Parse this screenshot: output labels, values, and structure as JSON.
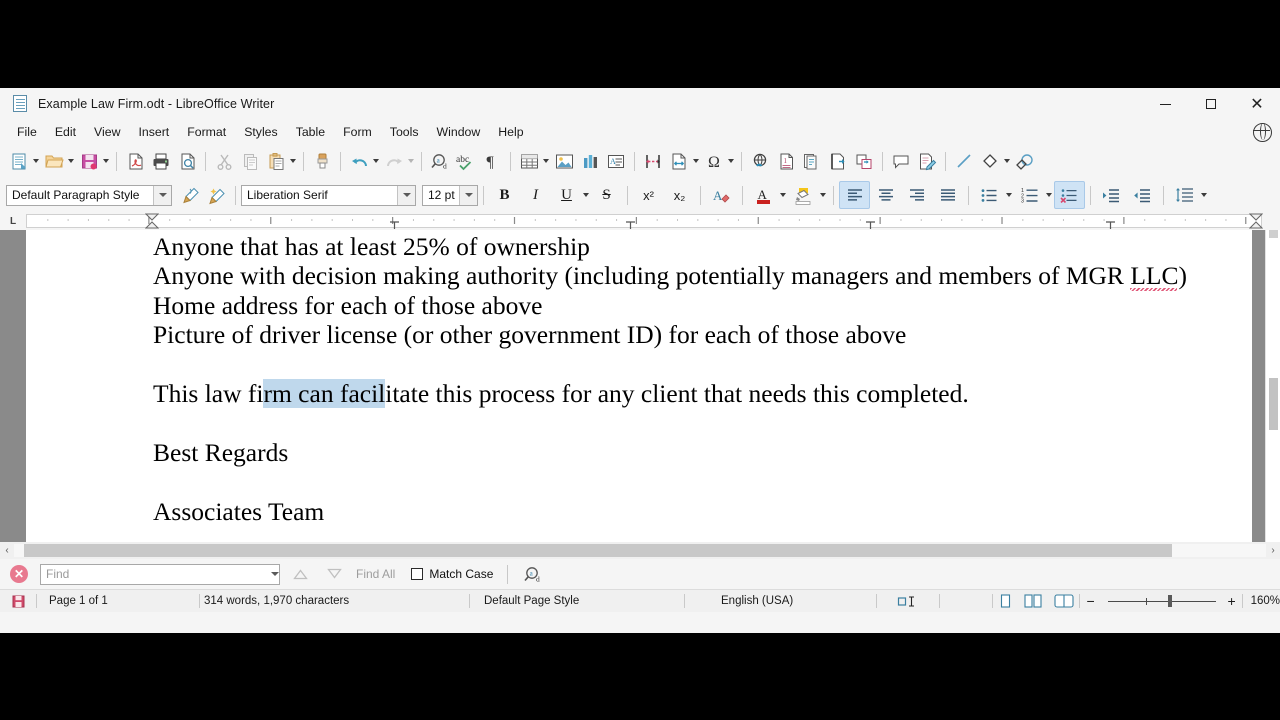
{
  "window": {
    "title": "Example Law Firm.odt - LibreOffice Writer",
    "minimize_label": "",
    "maximize_label": "",
    "close_label": "✕"
  },
  "menubar": {
    "items": [
      {
        "label": "File",
        "name": "menu-file"
      },
      {
        "label": "Edit",
        "name": "menu-edit"
      },
      {
        "label": "View",
        "name": "menu-view"
      },
      {
        "label": "Insert",
        "name": "menu-insert"
      },
      {
        "label": "Format",
        "name": "menu-format"
      },
      {
        "label": "Styles",
        "name": "menu-styles"
      },
      {
        "label": "Table",
        "name": "menu-table"
      },
      {
        "label": "Form",
        "name": "menu-form"
      },
      {
        "label": "Tools",
        "name": "menu-tools"
      },
      {
        "label": "Window",
        "name": "menu-window"
      },
      {
        "label": "Help",
        "name": "menu-help"
      }
    ],
    "language_icon": "globe-icon"
  },
  "standard_toolbar": {
    "icons": [
      "new-document-icon",
      "open-file-icon",
      "save-icon",
      "export-pdf-icon",
      "print-icon",
      "print-preview-icon",
      "cut-icon",
      "copy-icon",
      "paste-icon",
      "clone-formatting-icon",
      "undo-icon",
      "redo-icon",
      "find-replace-icon",
      "spelling-icon",
      "formatting-marks-icon",
      "insert-table-icon",
      "insert-image-icon",
      "insert-chart-icon",
      "insert-textbox-icon",
      "page-break-icon",
      "insert-field-icon",
      "special-character-icon",
      "insert-hyperlink-icon",
      "insert-footnote-icon",
      "insert-endnote-icon",
      "insert-bookmark-icon",
      "cross-reference-icon",
      "insert-comment-icon",
      "track-changes-icon",
      "insert-line-icon",
      "basic-shapes-icon",
      "show-draw-functions-icon"
    ]
  },
  "formatting_toolbar": {
    "paragraph_style": "Default Paragraph Style",
    "font_name": "Liberation Serif",
    "font_size": "12 pt",
    "bold_label": "B",
    "italic_label": "I",
    "underline_label": "U",
    "strikethrough_label": "S",
    "superscript_label": "x²",
    "subscript_label": "x₂",
    "clear_formatting_icon": "clear-formatting-icon",
    "font_color_icon": "font-color-icon",
    "highlight_icon": "highlighting-color-icon",
    "align_left_icon": "align-left-icon",
    "align_center_icon": "align-center-icon",
    "align_right_icon": "align-right-icon",
    "align_justified_icon": "align-justified-icon",
    "unordered_list_icon": "unordered-list-icon",
    "ordered_list_icon": "ordered-list-icon",
    "no_list_icon": "no-list-icon",
    "increase_indent_icon": "increase-indent-icon",
    "decrease_indent_icon": "decrease-indent-icon",
    "line_spacing_icon": "line-spacing-icon",
    "align_left_active": true,
    "no_list_active": true
  },
  "ruler": {
    "tab_selector_label": "L"
  },
  "document": {
    "lines": [
      {
        "text": "Anyone that has at least 25% of ownership"
      },
      {
        "pre": "Anyone with decision making authority (including potentially managers and members of MGR ",
        "misspelled": "LLC",
        "post": ")"
      },
      {
        "text": "Home address for each of those above"
      },
      {
        "text": "Picture of driver license (or other government ID) for each of those above"
      },
      {
        "blank": true
      },
      {
        "pre": "This law fi",
        "selected": "rm can facil",
        "post": "itate this process for any client that needs this completed."
      },
      {
        "blank": true
      },
      {
        "text": "Best Regards"
      },
      {
        "blank": true
      },
      {
        "text": "Associates Team"
      }
    ]
  },
  "findbar": {
    "close_label": "✕",
    "placeholder": "Find",
    "value": "",
    "find_previous_icon": "find-previous-icon",
    "find_next_icon": "find-next-icon",
    "find_all_label": "Find All",
    "match_case_label": "Match Case",
    "match_case_checked": false,
    "find_replace_icon": "find-and-replace-icon"
  },
  "statusbar": {
    "save_status_icon": "save-status-icon",
    "page_info": "Page 1 of 1",
    "word_count": "314 words, 1,970 characters",
    "page_style": "Default Page Style",
    "language": "English (USA)",
    "selection_mode_icon": "selection-mode-icon",
    "view_single_page_icon": "single-page-view-icon",
    "view_multi_page_icon": "multi-page-view-icon",
    "view_book_icon": "book-view-icon",
    "zoom_out_label": "−",
    "zoom_in_label": "+",
    "zoom_level": "160%"
  },
  "colors": {
    "selection_highlight": "#bfd8ec",
    "spellcheck_underline": "#e05a7a",
    "active_button": "#cfe3f5",
    "window_background": "#f5f5f5"
  }
}
